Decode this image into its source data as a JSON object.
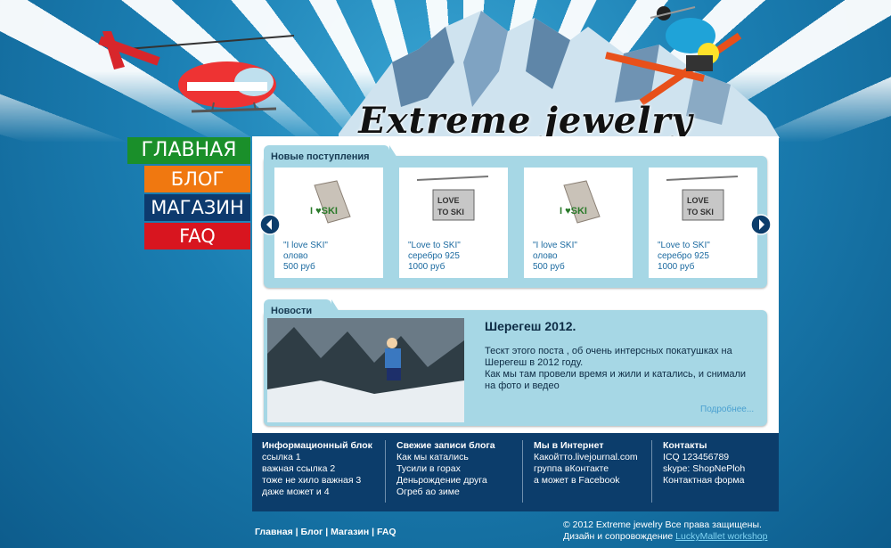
{
  "logo_text": "Extreme jewelry",
  "nav": {
    "home": "ГЛАВНАЯ",
    "blog": "БЛОГ",
    "shop": "МАГАЗИН",
    "faq": "FAQ"
  },
  "new_arrivals": {
    "title": "Новые поступления",
    "items": [
      {
        "title": "\"I love SKI\"",
        "material": "олово",
        "price": "500 руб"
      },
      {
        "title": "\"Love to SKI\"",
        "material": "серебро 925",
        "price": "1000 руб"
      },
      {
        "title": "\"I love SKI\"",
        "material": "олово",
        "price": "500 руб"
      },
      {
        "title": "\"Love to SKI\"",
        "material": "серебро 925",
        "price": "1000 руб"
      }
    ]
  },
  "news": {
    "title": "Новости",
    "post_title": "Шерегеш 2012.",
    "post_text_1": "Тескт этого поста , об очень интерсных покатушках на Шерегеш в 2012 году.",
    "post_text_2": "Как мы там провели время и жили и катались, и снимали на фото и ведео",
    "more": "Подробнее..."
  },
  "footer": {
    "info": {
      "title": "Информационный блок",
      "links": [
        "ссылка 1",
        "важная ссылка 2",
        "тоже не хило важная 3",
        "даже может и 4"
      ]
    },
    "blog": {
      "title": "Свежие записи блога",
      "links": [
        "Как мы катались",
        "Тусили в горах",
        "Деньрождение друга",
        "Огреб ао зиме"
      ]
    },
    "web": {
      "title": "Мы в Интернет",
      "links": [
        "Какойтто.livejournal.com",
        "группа вКонтакте",
        "а может в Facebook"
      ]
    },
    "contacts": {
      "title": "Контакты",
      "links": [
        "ICQ 123456789",
        "skype: ShopNePloh",
        "Контактная форма"
      ]
    }
  },
  "bottom_nav": [
    "Главная",
    "Блог",
    "Магазин",
    "FAQ"
  ],
  "bottom_nav_sep": " | ",
  "copyright": "© 2012 Extreme jewelry Все права защищены.",
  "design_credit": "Дизайн и сопровождение ",
  "design_studio": "LuckyMallet workshop",
  "colors": {
    "nav_home": "#1a8f2a",
    "nav_blog": "#f07810",
    "nav_shop": "#0d3a6e",
    "nav_faq": "#d8151f",
    "panel": "#a6d7e5",
    "footer": "#0c3d6b"
  },
  "icons": [
    "helicopter-icon",
    "mountain-icon",
    "skier-icon",
    "arrow-left-icon",
    "arrow-right-icon"
  ]
}
